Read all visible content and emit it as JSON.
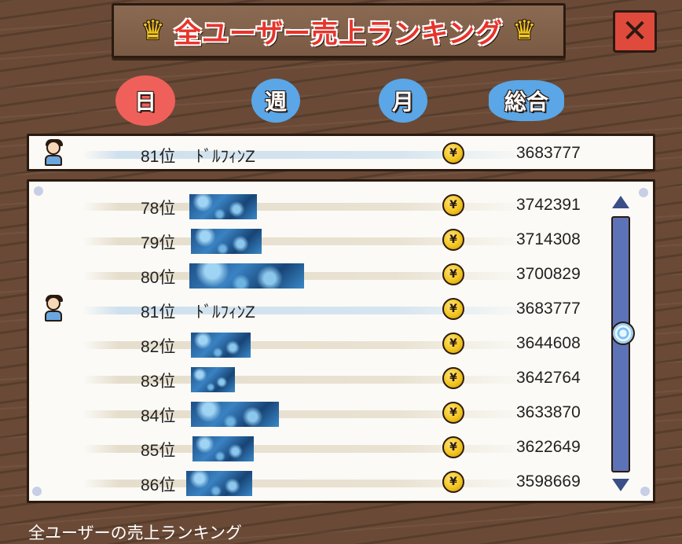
{
  "header": {
    "title": "全ユーザー売上ランキング"
  },
  "tabs": [
    {
      "label": "日",
      "active": true
    },
    {
      "label": "週",
      "active": false
    },
    {
      "label": "月",
      "active": false
    },
    {
      "label": "総合",
      "active": false
    }
  ],
  "coin_glyph": "¥",
  "self_row": {
    "rank": "81位",
    "name": "ﾄﾞﾙﾌｨﾝZ",
    "score": "3683777"
  },
  "rows": [
    {
      "rank": "78位",
      "name": "",
      "score": "3742391"
    },
    {
      "rank": "79位",
      "name": "",
      "score": "3714308"
    },
    {
      "rank": "80位",
      "name": "",
      "score": "3700829"
    },
    {
      "rank": "81位",
      "name": "ﾄﾞﾙﾌｨﾝZ",
      "score": "3683777"
    },
    {
      "rank": "82位",
      "name": "",
      "score": "3644608"
    },
    {
      "rank": "83位",
      "name": "",
      "score": "3642764"
    },
    {
      "rank": "84位",
      "name": "",
      "score": "3633870"
    },
    {
      "rank": "85位",
      "name": "",
      "score": "3622649"
    },
    {
      "rank": "86位",
      "name": "",
      "score": "3598669"
    }
  ],
  "footer": "全ユーザーの売上ランキング",
  "colors": {
    "title_red": "#e8342c",
    "tab_active": "#f0605a",
    "tab_inactive": "#5aa6e6",
    "wood": "#6a4a36"
  }
}
